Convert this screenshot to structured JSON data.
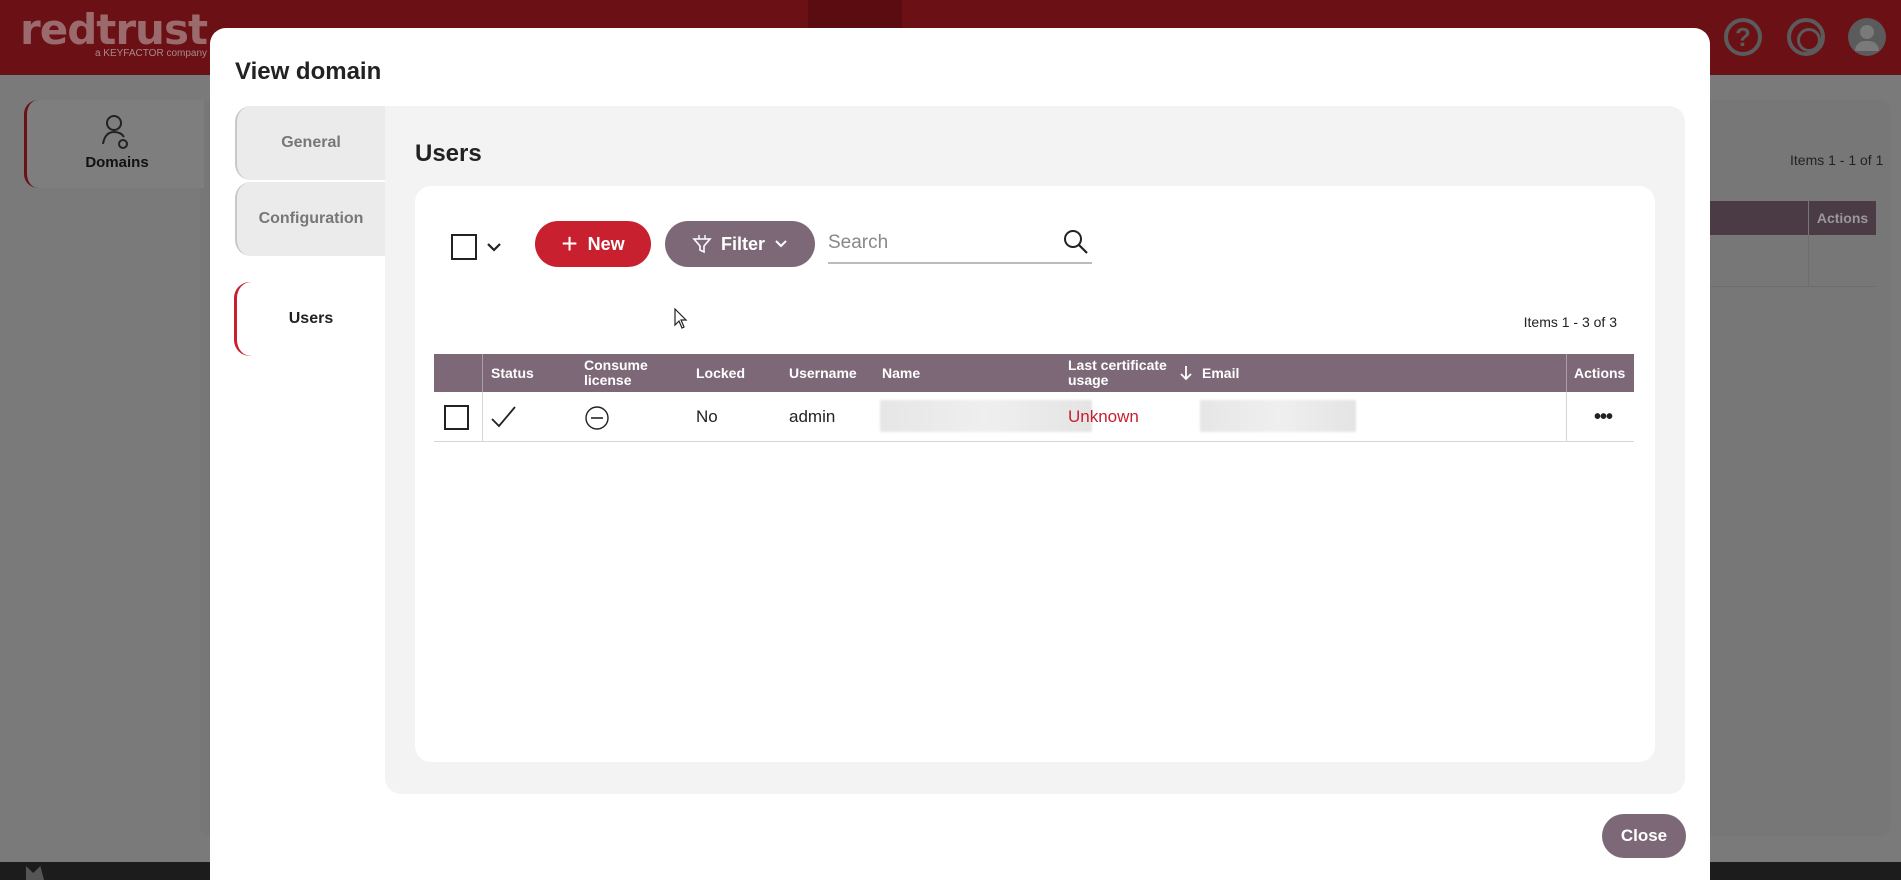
{
  "app": {
    "logo_text": "redtrust",
    "logo_sub": "a KEYFACTOR company",
    "help_glyph": "?",
    "side_nav": {
      "label": "Domains"
    },
    "background_items_count": "Items 1 - 1 of 1",
    "background_actions_header": "Actions"
  },
  "modal": {
    "title": "View domain",
    "tabs": [
      {
        "label": "General"
      },
      {
        "label": "Configuration"
      },
      {
        "label": "Users",
        "active": true
      }
    ],
    "section_title": "Users",
    "toolbar": {
      "new_label": "New",
      "filter_label": "Filter",
      "search_placeholder": "Search"
    },
    "items_count": "Items 1 - 3 of 3",
    "table": {
      "columns": [
        "Status",
        "Consume license",
        "Locked",
        "Username",
        "Name",
        "Last certificate usage",
        "Email",
        "Actions"
      ],
      "rows": [
        {
          "locked": "No",
          "username": "admin",
          "last_usage": "Unknown"
        }
      ]
    },
    "close_label": "Close"
  },
  "colors": {
    "brand_red": "#c8202f",
    "header_purple": "#7d6877"
  }
}
